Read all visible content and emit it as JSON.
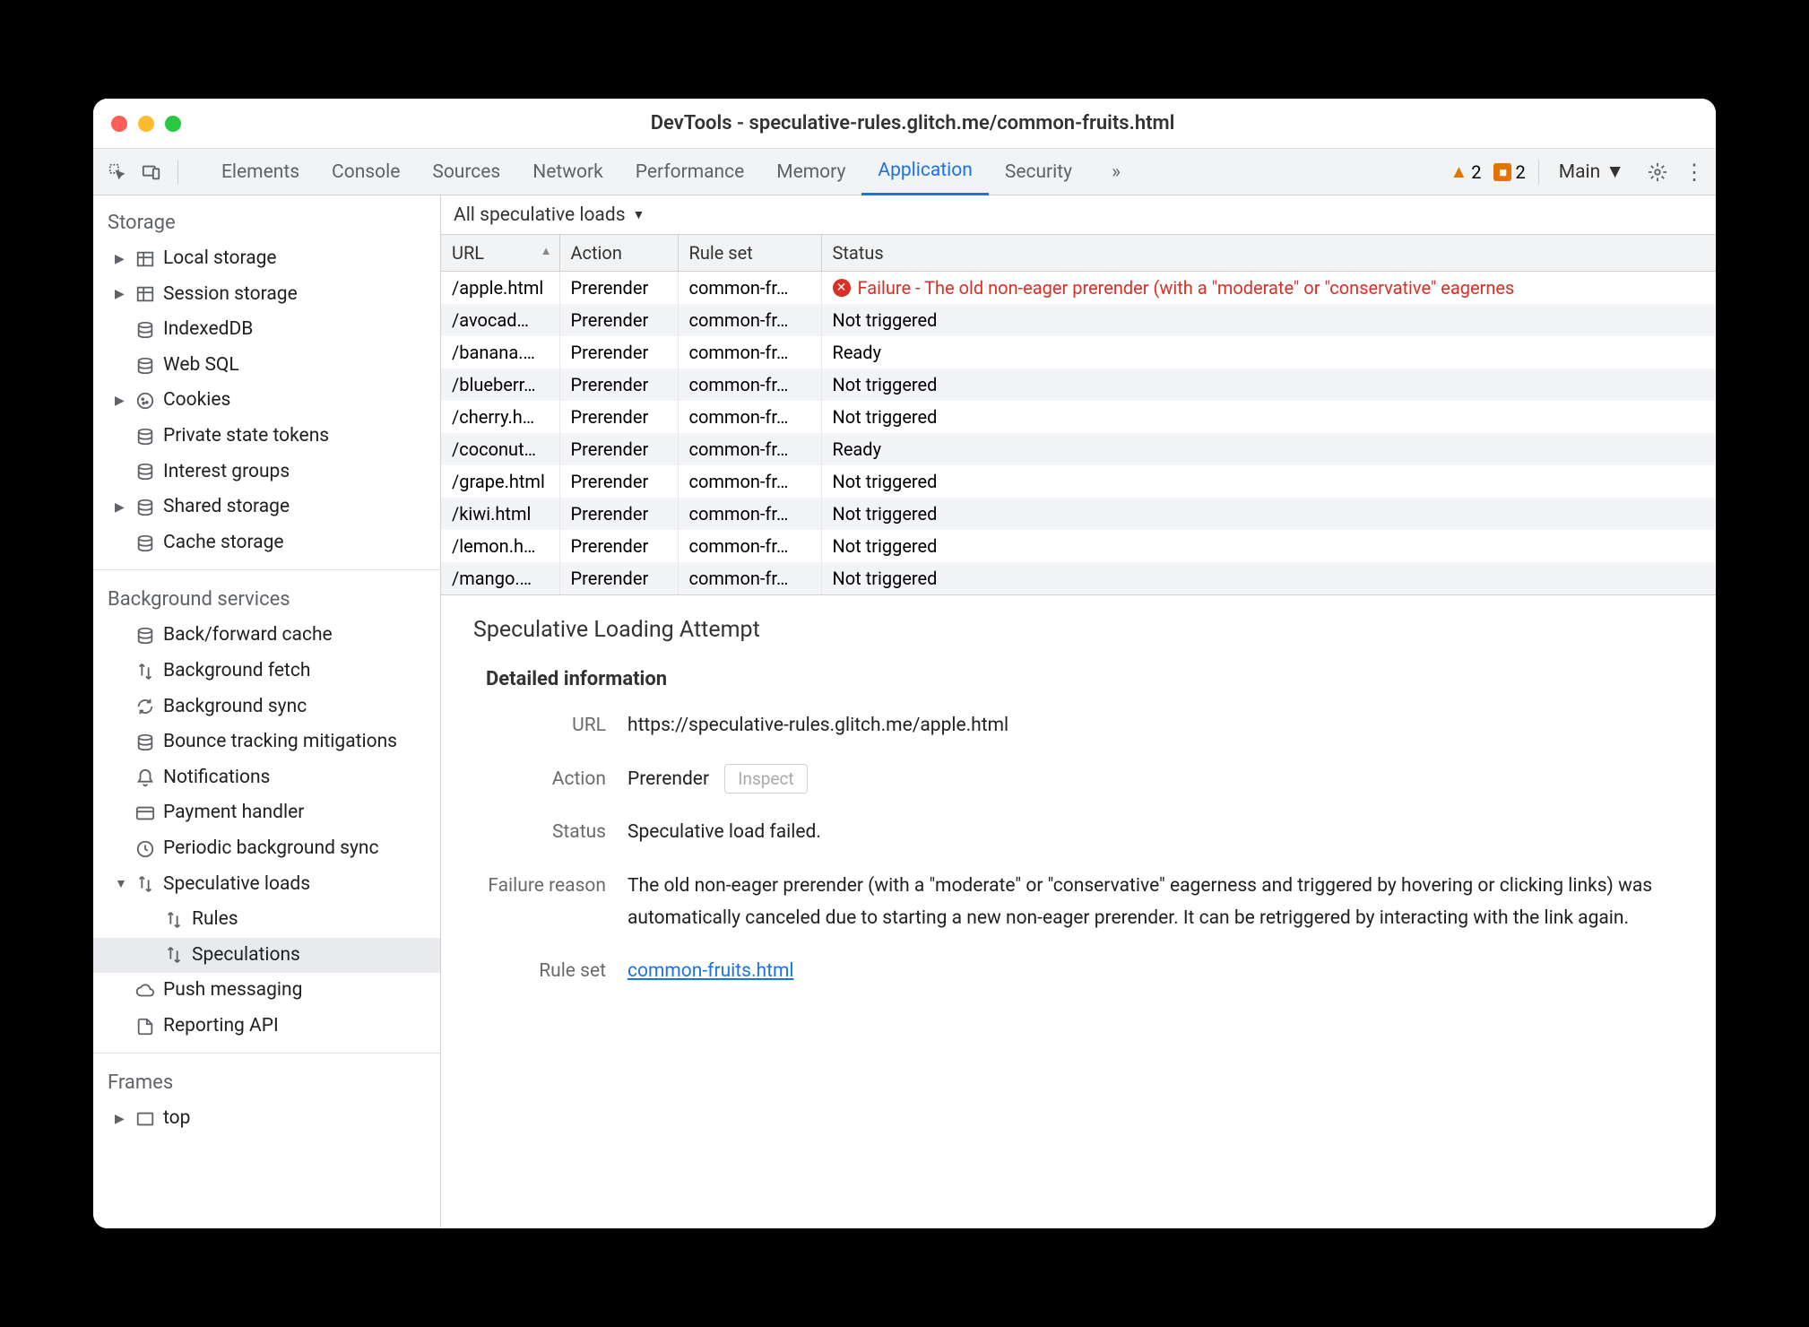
{
  "window": {
    "title": "DevTools - speculative-rules.glitch.me/common-fruits.html"
  },
  "toolbar": {
    "tabs": [
      "Elements",
      "Console",
      "Sources",
      "Network",
      "Performance",
      "Memory",
      "Application",
      "Security"
    ],
    "active_tab": "Application",
    "overflow": "»",
    "warnings": "2",
    "errors": "2",
    "target": "Main"
  },
  "sidebar": {
    "storage": {
      "title": "Storage",
      "items": [
        {
          "label": "Local storage",
          "icon": "table",
          "expand": true
        },
        {
          "label": "Session storage",
          "icon": "table",
          "expand": true
        },
        {
          "label": "IndexedDB",
          "icon": "db"
        },
        {
          "label": "Web SQL",
          "icon": "db"
        },
        {
          "label": "Cookies",
          "icon": "cookie",
          "expand": true
        },
        {
          "label": "Private state tokens",
          "icon": "db"
        },
        {
          "label": "Interest groups",
          "icon": "db"
        },
        {
          "label": "Shared storage",
          "icon": "db",
          "expand": true
        },
        {
          "label": "Cache storage",
          "icon": "db"
        }
      ]
    },
    "background": {
      "title": "Background services",
      "items": [
        {
          "label": "Back/forward cache",
          "icon": "db"
        },
        {
          "label": "Background fetch",
          "icon": "updown"
        },
        {
          "label": "Background sync",
          "icon": "sync"
        },
        {
          "label": "Bounce tracking mitigations",
          "icon": "db"
        },
        {
          "label": "Notifications",
          "icon": "bell"
        },
        {
          "label": "Payment handler",
          "icon": "card"
        },
        {
          "label": "Periodic background sync",
          "icon": "clock"
        },
        {
          "label": "Speculative loads",
          "icon": "updown",
          "expand": true,
          "expanded": true
        },
        {
          "label": "Rules",
          "icon": "updown",
          "indent": true
        },
        {
          "label": "Speculations",
          "icon": "updown",
          "indent": true,
          "selected": true
        },
        {
          "label": "Push messaging",
          "icon": "cloud"
        },
        {
          "label": "Reporting API",
          "icon": "file"
        }
      ]
    },
    "frames": {
      "title": "Frames",
      "items": [
        {
          "label": "top",
          "icon": "frame",
          "expand": true
        }
      ]
    }
  },
  "filter": {
    "label": "All speculative loads"
  },
  "table": {
    "headers": [
      "URL",
      "Action",
      "Rule set",
      "Status"
    ],
    "rows": [
      {
        "url": "/apple.html",
        "action": "Prerender",
        "rule": "common-fr…",
        "status": "Failure - The old non-eager prerender (with a \"moderate\" or \"conservative\" eagernes",
        "fail": true
      },
      {
        "url": "/avocad…",
        "action": "Prerender",
        "rule": "common-fr…",
        "status": "Not triggered"
      },
      {
        "url": "/banana.…",
        "action": "Prerender",
        "rule": "common-fr…",
        "status": "Ready"
      },
      {
        "url": "/blueberr…",
        "action": "Prerender",
        "rule": "common-fr…",
        "status": "Not triggered"
      },
      {
        "url": "/cherry.h…",
        "action": "Prerender",
        "rule": "common-fr…",
        "status": "Not triggered"
      },
      {
        "url": "/coconut…",
        "action": "Prerender",
        "rule": "common-fr…",
        "status": "Ready"
      },
      {
        "url": "/grape.html",
        "action": "Prerender",
        "rule": "common-fr…",
        "status": "Not triggered"
      },
      {
        "url": "/kiwi.html",
        "action": "Prerender",
        "rule": "common-fr…",
        "status": "Not triggered"
      },
      {
        "url": "/lemon.h…",
        "action": "Prerender",
        "rule": "common-fr…",
        "status": "Not triggered"
      },
      {
        "url": "/mango.…",
        "action": "Prerender",
        "rule": "common-fr…",
        "status": "Not triggered"
      }
    ]
  },
  "detail": {
    "title": "Speculative Loading Attempt",
    "section": "Detailed information",
    "rows": {
      "url_label": "URL",
      "url_value": "https://speculative-rules.glitch.me/apple.html",
      "action_label": "Action",
      "action_value": "Prerender",
      "inspect": "Inspect",
      "status_label": "Status",
      "status_value": "Speculative load failed.",
      "failure_label": "Failure reason",
      "failure_value": "The old non-eager prerender (with a \"moderate\" or \"conservative\" eagerness and triggered by hovering or clicking links) was automatically canceled due to starting a new non-eager prerender. It can be retriggered by interacting with the link again.",
      "ruleset_label": "Rule set",
      "ruleset_value": "common-fruits.html"
    }
  }
}
